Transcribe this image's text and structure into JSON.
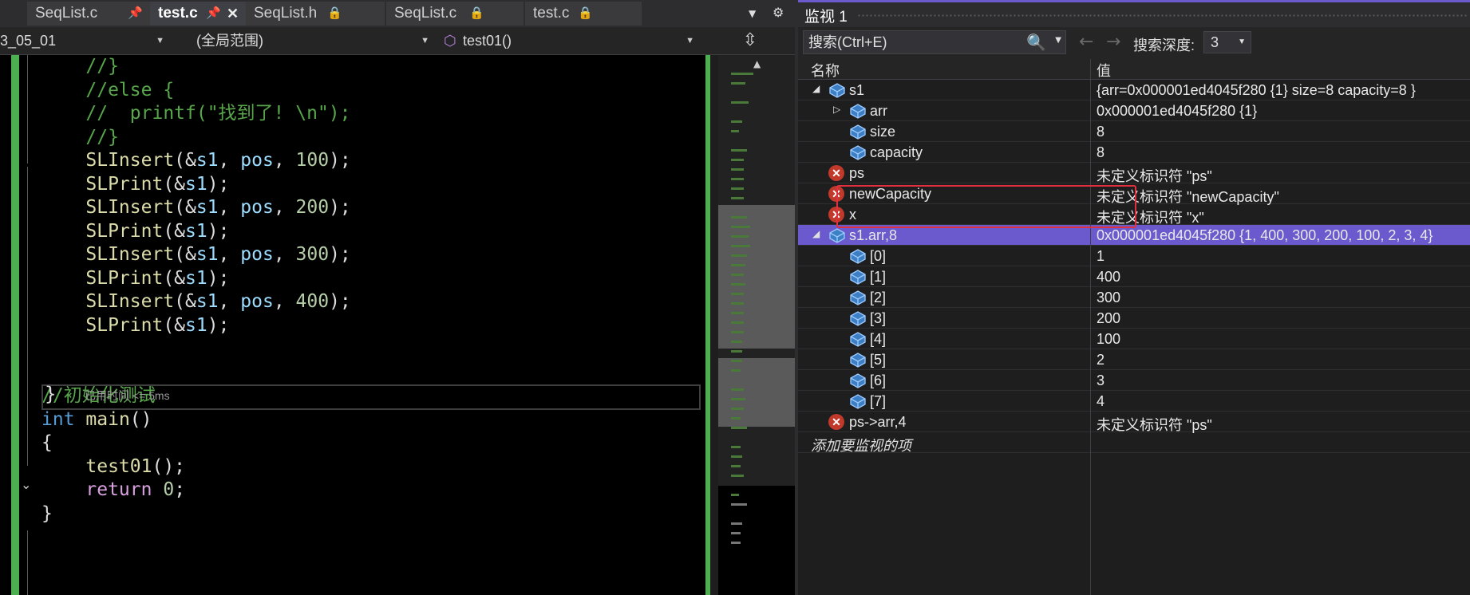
{
  "editor": {
    "tabs": [
      {
        "label": "SeqList.c",
        "icon": "pin-icon",
        "active": false
      },
      {
        "label": "test.c",
        "icon": "pin-icon",
        "active": true
      },
      {
        "label": "SeqList.h",
        "icon": "lock-icon",
        "active": false
      },
      {
        "label": "SeqList.c",
        "icon": "lock-icon",
        "active": false
      },
      {
        "label": "test.c",
        "icon": "lock-icon",
        "active": false
      }
    ],
    "nav": {
      "project": "3_05_01",
      "scope": "(全局范围)",
      "function": "test01()"
    },
    "timing": "已用时间 <= 5ms",
    "code": [
      {
        "parts": [
          [
            "c-comment",
            "    //}"
          ]
        ]
      },
      {
        "parts": [
          [
            "c-comment",
            "    //else {"
          ]
        ]
      },
      {
        "parts": [
          [
            "c-comment",
            "    //  printf(\"找到了! \\n\");"
          ]
        ]
      },
      {
        "parts": [
          [
            "c-comment",
            "    //}"
          ]
        ]
      },
      {
        "parts": [
          [
            "c-fn",
            "    SLInsert"
          ],
          [
            "c-pl",
            "(&"
          ],
          [
            "c-id",
            "s1"
          ],
          [
            "c-pl",
            ", "
          ],
          [
            "c-id",
            "pos"
          ],
          [
            "c-pl",
            ", "
          ],
          [
            "c-num",
            "100"
          ],
          [
            "c-pl",
            ");"
          ]
        ]
      },
      {
        "parts": [
          [
            "c-fn",
            "    SLPrint"
          ],
          [
            "c-pl",
            "(&"
          ],
          [
            "c-id",
            "s1"
          ],
          [
            "c-pl",
            ");"
          ]
        ]
      },
      {
        "parts": [
          [
            "c-fn",
            "    SLInsert"
          ],
          [
            "c-pl",
            "(&"
          ],
          [
            "c-id",
            "s1"
          ],
          [
            "c-pl",
            ", "
          ],
          [
            "c-id",
            "pos"
          ],
          [
            "c-pl",
            ", "
          ],
          [
            "c-num",
            "200"
          ],
          [
            "c-pl",
            ");"
          ]
        ]
      },
      {
        "parts": [
          [
            "c-fn",
            "    SLPrint"
          ],
          [
            "c-pl",
            "(&"
          ],
          [
            "c-id",
            "s1"
          ],
          [
            "c-pl",
            ");"
          ]
        ]
      },
      {
        "parts": [
          [
            "c-fn",
            "    SLInsert"
          ],
          [
            "c-pl",
            "(&"
          ],
          [
            "c-id",
            "s1"
          ],
          [
            "c-pl",
            ", "
          ],
          [
            "c-id",
            "pos"
          ],
          [
            "c-pl",
            ", "
          ],
          [
            "c-num",
            "300"
          ],
          [
            "c-pl",
            ");"
          ]
        ]
      },
      {
        "parts": [
          [
            "c-fn",
            "    SLPrint"
          ],
          [
            "c-pl",
            "(&"
          ],
          [
            "c-id",
            "s1"
          ],
          [
            "c-pl",
            ");"
          ]
        ]
      },
      {
        "parts": [
          [
            "c-fn",
            "    SLInsert"
          ],
          [
            "c-pl",
            "(&"
          ],
          [
            "c-id",
            "s1"
          ],
          [
            "c-pl",
            ", "
          ],
          [
            "c-id",
            "pos"
          ],
          [
            "c-pl",
            ", "
          ],
          [
            "c-num",
            "400"
          ],
          [
            "c-pl",
            ");"
          ]
        ]
      },
      {
        "parts": [
          [
            "c-fn",
            "    SLPrint"
          ],
          [
            "c-pl",
            "(&"
          ],
          [
            "c-id",
            "s1"
          ],
          [
            "c-pl",
            ");"
          ]
        ]
      },
      {
        "parts": []
      },
      {
        "parts": []
      },
      {
        "parts": [
          [
            "c-comment",
            "//初始化测试"
          ]
        ]
      },
      {
        "parts": [
          [
            "c-kw",
            "int"
          ],
          [
            "c-pl",
            " "
          ],
          [
            "c-fn",
            "main"
          ],
          [
            "c-pl",
            "()"
          ]
        ]
      },
      {
        "parts": [
          [
            "c-pl",
            "{"
          ]
        ]
      },
      {
        "parts": [
          [
            "c-fn",
            "    test01"
          ],
          [
            "c-pl",
            "();"
          ]
        ]
      },
      {
        "parts": [
          [
            "c-ctl",
            "    return"
          ],
          [
            "c-pl",
            " "
          ],
          [
            "c-num",
            "0"
          ],
          [
            "c-pl",
            ";"
          ]
        ]
      },
      {
        "parts": [
          [
            "c-pl",
            "}"
          ]
        ]
      }
    ]
  },
  "watch": {
    "title": "监视 1",
    "search_placeholder": "搜索(Ctrl+E)",
    "depth_label": "搜索深度:",
    "depth_value": "3",
    "col_name": "名称",
    "col_value": "值",
    "add_item": "添加要监视的项",
    "rows": [
      {
        "name": "s1",
        "value": "{arr=0x000001ed4045f280 {1} size=8 capacity=8 }",
        "indent": 0,
        "expander": "expanded",
        "icon": "object-icon",
        "selected": false
      },
      {
        "name": "arr",
        "value": "0x000001ed4045f280 {1}",
        "indent": 1,
        "expander": "collapsed",
        "icon": "object-icon",
        "selected": false
      },
      {
        "name": "size",
        "value": "8",
        "indent": 1,
        "expander": "none",
        "icon": "object-icon",
        "selected": false
      },
      {
        "name": "capacity",
        "value": "8",
        "indent": 1,
        "expander": "none",
        "icon": "object-icon",
        "selected": false
      },
      {
        "name": "ps",
        "value": "未定义标识符 \"ps\"",
        "indent": 0,
        "expander": "none",
        "icon": "error-icon",
        "selected": false
      },
      {
        "name": "newCapacity",
        "value": "未定义标识符 \"newCapacity\"",
        "indent": 0,
        "expander": "none",
        "icon": "error-icon",
        "selected": false
      },
      {
        "name": "x",
        "value": "未定义标识符 \"x\"",
        "indent": 0,
        "expander": "none",
        "icon": "error-icon",
        "selected": false
      },
      {
        "name": "s1.arr,8",
        "value": "0x000001ed4045f280 {1, 400, 300, 200, 100, 2, 3, 4}",
        "indent": 0,
        "expander": "expanded",
        "icon": "object-icon",
        "selected": true
      },
      {
        "name": "[0]",
        "value": "1",
        "indent": 1,
        "expander": "none",
        "icon": "object-icon",
        "selected": false
      },
      {
        "name": "[1]",
        "value": "400",
        "indent": 1,
        "expander": "none",
        "icon": "object-icon",
        "selected": false
      },
      {
        "name": "[2]",
        "value": "300",
        "indent": 1,
        "expander": "none",
        "icon": "object-icon",
        "selected": false
      },
      {
        "name": "[3]",
        "value": "200",
        "indent": 1,
        "expander": "none",
        "icon": "object-icon",
        "selected": false
      },
      {
        "name": "[4]",
        "value": "100",
        "indent": 1,
        "expander": "none",
        "icon": "object-icon",
        "selected": false
      },
      {
        "name": "[5]",
        "value": "2",
        "indent": 1,
        "expander": "none",
        "icon": "object-icon",
        "selected": false
      },
      {
        "name": "[6]",
        "value": "3",
        "indent": 1,
        "expander": "none",
        "icon": "object-icon",
        "selected": false
      },
      {
        "name": "[7]",
        "value": "4",
        "indent": 1,
        "expander": "none",
        "icon": "object-icon",
        "selected": false
      },
      {
        "name": "ps->arr,4",
        "value": "未定义标识符 \"ps\"",
        "indent": 0,
        "expander": "none",
        "icon": "error-icon",
        "selected": false
      }
    ]
  },
  "colors": {
    "selection": "#6a5acd",
    "gutter_change": "#4caf50",
    "highlight_border": "#e03040",
    "error": "#c0392b"
  }
}
